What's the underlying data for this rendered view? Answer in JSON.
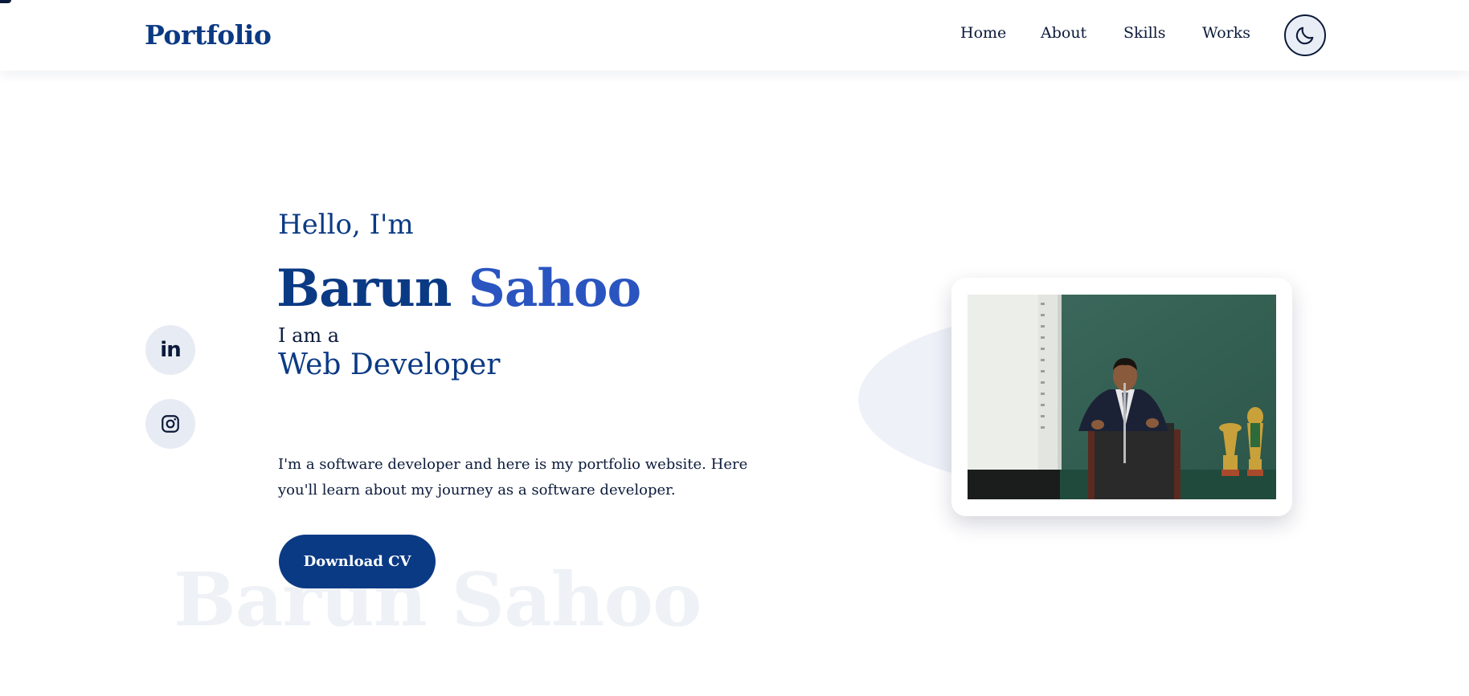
{
  "header": {
    "logo": "Portfolio",
    "nav": [
      "Home",
      "About",
      "Skills",
      "Works"
    ],
    "theme_toggle_icon": "moon-icon"
  },
  "social": [
    {
      "name": "linkedin-icon",
      "text": "in"
    },
    {
      "name": "instagram-icon"
    }
  ],
  "hero": {
    "greeting": "Hello, I'm",
    "first_name": "Barun",
    "last_name": "Sahoo",
    "intro": "I am a",
    "role": "Web Developer",
    "description": "I'm a software developer and here is my portfolio website. Here you'll learn about my journey as a software developer.",
    "cta": "Download CV",
    "watermark": "Barun Sahoo"
  },
  "colors": {
    "primary": "#0b3a84",
    "accent": "#2a55c0",
    "text": "#0b1a3a",
    "chip": "#e7ebf3"
  }
}
